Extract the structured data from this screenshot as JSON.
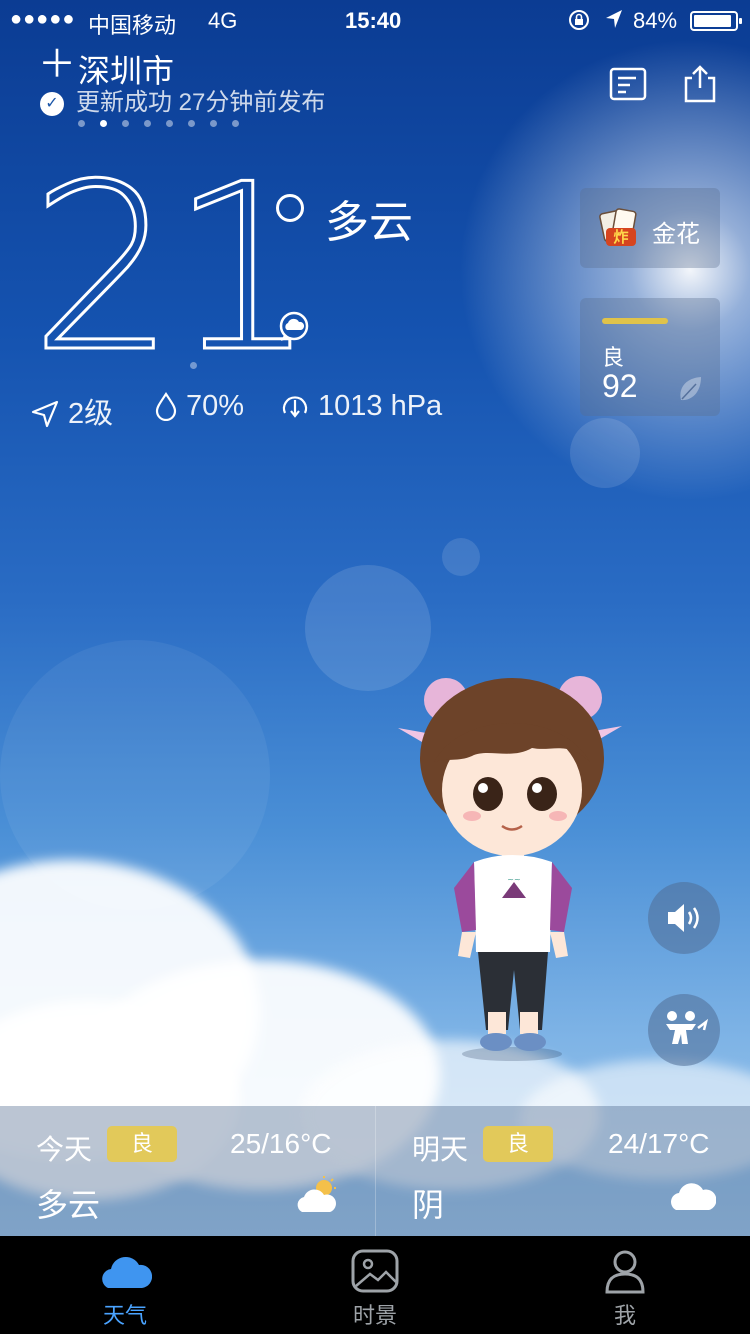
{
  "status_bar": {
    "signal_dots": "●●●●●",
    "carrier": "中国移动",
    "network": "4G",
    "time": "15:40",
    "battery": "84%",
    "battery_level": 0.84
  },
  "header": {
    "city": "深圳市",
    "update_status": "更新成功 27分钟前发布",
    "page_count": 8,
    "active_page": 1
  },
  "current": {
    "temperature": "21",
    "condition": "多云",
    "wind": "2级",
    "humidity": "70%",
    "pressure": "1013 hPa"
  },
  "cards": {
    "ad_label": "金花",
    "aqi_level": "良",
    "aqi_value": "92"
  },
  "forecast": {
    "today": {
      "day": "今天",
      "aqi": "良",
      "range": "25/16°C",
      "condition": "多云",
      "icon": "partly-cloudy-icon"
    },
    "tomorrow": {
      "day": "明天",
      "aqi": "良",
      "range": "24/17°C",
      "condition": "阴",
      "icon": "cloud-icon"
    }
  },
  "tabs": [
    {
      "label": "天气",
      "icon": "cloud-icon",
      "active": true
    },
    {
      "label": "时景",
      "icon": "photo-icon",
      "active": false
    },
    {
      "label": "我",
      "icon": "person-icon",
      "active": false
    }
  ],
  "colors": {
    "aqi_good": "#e2c95a",
    "tab_active": "#4aa3ff",
    "tab_inactive": "#9ea3a8"
  }
}
